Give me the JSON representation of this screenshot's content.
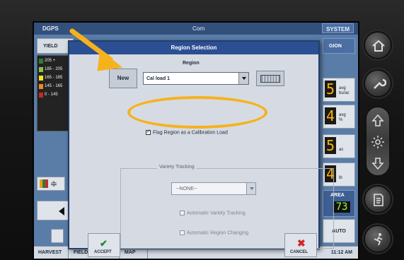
{
  "status_bar": {
    "gps": "DGPS",
    "crop": "Corn",
    "system": "SYSTEM"
  },
  "left_panel": {
    "yield_tab": "YIELD",
    "legend": [
      {
        "label": "205 +",
        "color": "#2f7d2f"
      },
      {
        "label": "185 - 205",
        "color": "#8bc34a"
      },
      {
        "label": "165 - 185",
        "color": "#f1e51f"
      },
      {
        "label": "145 - 165",
        "color": "#f08a1c"
      },
      {
        "label": "0 - 145",
        "color": "#c52a24"
      }
    ]
  },
  "right_panel": {
    "tab": "GION",
    "readouts": [
      {
        "value": "5",
        "unit1": "avg",
        "unit2": "bu/ac"
      },
      {
        "value": "4",
        "unit1": "avg",
        "unit2": "%"
      },
      {
        "value": "5",
        "unit1": "",
        "unit2": "ac"
      },
      {
        "value": "4",
        "unit1": "",
        "unit2": "lb"
      }
    ],
    "area_label": "AREA",
    "area_value": "73",
    "auto_label": "AUTO"
  },
  "dialog": {
    "title": "Region Selection",
    "region_label": "Region",
    "new_button": "New",
    "region_value": "Cal load 1",
    "flag_label": "Flag Region as a Calibration Load",
    "flag_checked": true,
    "variety_group_label": "Variety Tracking",
    "variety_value": "--NONE--",
    "auto_variety_label": "Automatic Variety Tracking",
    "auto_region_label": "Automatic Region Changing",
    "accept_label": "ACCEPT",
    "cancel_label": "CANCEL"
  },
  "bottom_bar": {
    "harvest": "HARVEST",
    "field_notes": "FIELD NOTES",
    "map": "MAP",
    "time": "11:12 AM"
  },
  "colors": {
    "annotation": "#f5b21d",
    "title_bar": "#2c4f93"
  },
  "hardware_buttons": [
    "home-icon",
    "wrench-icon",
    "arrow-up-icon",
    "brightness-icon",
    "arrow-down-icon",
    "document-icon",
    "running-person-icon"
  ]
}
